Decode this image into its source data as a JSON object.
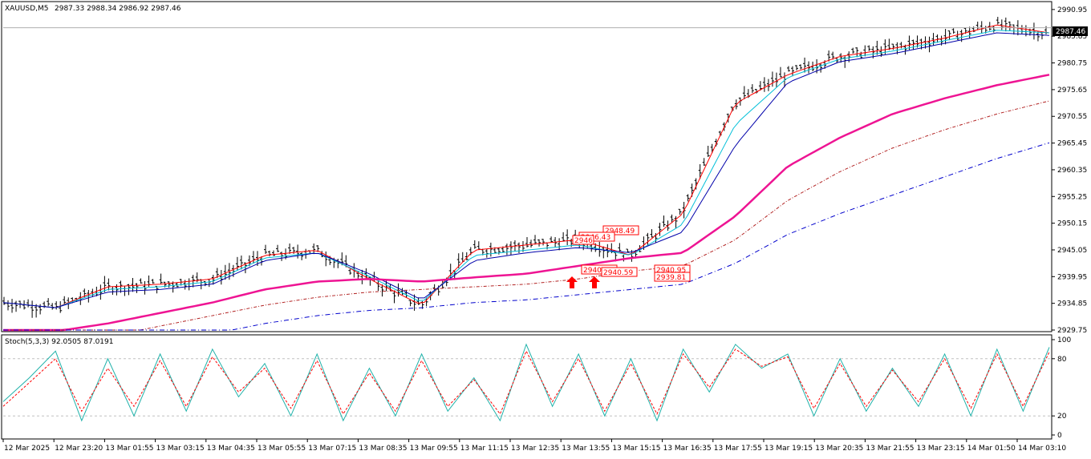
{
  "main_panel": {
    "symbol": "XAUUSD,M5",
    "ohlc": "2987.33 2988.34 2986.92 2987.46",
    "current_price_label": "2987.46",
    "price_ticks": [
      "2990.95",
      "2985.85",
      "2980.75",
      "2975.65",
      "2970.55",
      "2965.45",
      "2960.35",
      "2955.25",
      "2950.15",
      "2945.05",
      "2939.95",
      "2934.85",
      "2929.75"
    ],
    "annotations": [
      "2948.49",
      "2946.43",
      "2946",
      "2940.97",
      "2940.59",
      "2940.95",
      "2939.81"
    ]
  },
  "stoch_panel": {
    "title": "Stoch(5,3,3) 92.0505 87.0191",
    "level_ticks": [
      "100",
      "80",
      "20",
      "0"
    ]
  },
  "time_ticks": [
    "12 Mar 2025",
    "12 Mar 23:20",
    "13 Mar 01:55",
    "13 Mar 03:15",
    "13 Mar 04:35",
    "13 Mar 05:55",
    "13 Mar 07:15",
    "13 Mar 08:35",
    "13 Mar 09:55",
    "13 Mar 11:15",
    "13 Mar 12:35",
    "13 Mar 13:55",
    "13 Mar 15:15",
    "13 Mar 16:35",
    "13 Mar 17:55",
    "13 Mar 19:15",
    "13 Mar 20:35",
    "13 Mar 21:55",
    "13 Mar 23:15",
    "14 Mar 01:50",
    "14 Mar 03:10"
  ],
  "colors": {
    "background": "#ffffff",
    "price_bars": "#000000",
    "ma_fast": "#ff0000",
    "ma_mid": "#00bfd8",
    "ma_slow": "#0000aa",
    "ma_long": "#ee1493",
    "ma_long_dashed": "#b22222",
    "ma_longest_dashed": "#0000cc",
    "stoch_main": "#20b2aa",
    "stoch_signal": "#ff0000",
    "arrows": "#ff0000",
    "grid_level": "#c0c0c0"
  },
  "chart_data": [
    {
      "type": "line",
      "title": "XAUUSD,M5",
      "ylim": [
        2929.75,
        2992.0
      ],
      "x": [
        "12 Mar 2025",
        "12 Mar 23:20",
        "13 Mar 01:55",
        "13 Mar 03:15",
        "13 Mar 04:35",
        "13 Mar 05:55",
        "13 Mar 07:15",
        "13 Mar 08:35",
        "13 Mar 09:55",
        "13 Mar 11:15",
        "13 Mar 12:35",
        "13 Mar 13:55",
        "13 Mar 15:15",
        "13 Mar 16:35",
        "13 Mar 17:55",
        "13 Mar 19:15",
        "13 Mar 20:35",
        "13 Mar 21:55",
        "13 Mar 23:15",
        "14 Mar 01:50",
        "14 Mar 03:10"
      ],
      "series": [
        {
          "values": [
            2935.0,
            2934.0,
            2938.0,
            2938.5,
            2939.5,
            2944.0,
            2945.0,
            2939.5,
            2934.5,
            2945.0,
            2946.0,
            2947.0,
            2944.0,
            2952.0,
            2973.0,
            2978.5,
            2982.0,
            2983.5,
            2985.5,
            2988.0,
            2986.5
          ]
        },
        {
          "values": [
            2935.0,
            2934.0,
            2937.5,
            2938.0,
            2939.0,
            2943.5,
            2944.5,
            2940.0,
            2935.0,
            2944.0,
            2945.0,
            2946.0,
            2944.0,
            2950.0,
            2969.0,
            2978.0,
            2981.5,
            2983.0,
            2985.0,
            2987.0,
            2986.5
          ]
        },
        {
          "values": [
            2935.0,
            2934.0,
            2937.0,
            2937.5,
            2938.5,
            2943.0,
            2944.5,
            2940.5,
            2935.5,
            2943.0,
            2944.5,
            2945.5,
            2944.5,
            2948.5,
            2965.0,
            2977.0,
            2981.0,
            2982.5,
            2984.5,
            2986.5,
            2986.0
          ]
        },
        {
          "values": [
            2929.0,
            2929.5,
            2931.0,
            2933.0,
            2935.0,
            2937.5,
            2939.0,
            2939.5,
            2939.0,
            2939.8,
            2940.5,
            2942.0,
            2943.5,
            2944.5,
            2951.5,
            2961.0,
            2966.5,
            2971.0,
            2974.0,
            2976.5,
            2978.5
          ]
        },
        {
          "values": [
            2927.0,
            2927.5,
            2928.5,
            2930.5,
            2932.5,
            2934.5,
            2936.0,
            2937.0,
            2937.5,
            2938.0,
            2938.5,
            2939.5,
            2941.0,
            2942.0,
            2947.0,
            2954.5,
            2960.0,
            2964.5,
            2968.0,
            2971.0,
            2973.5
          ]
        },
        {
          "values": [
            2924.0,
            2925.0,
            2926.0,
            2927.5,
            2929.0,
            2931.0,
            2932.5,
            2933.5,
            2934.0,
            2935.0,
            2935.5,
            2936.5,
            2937.5,
            2938.5,
            2942.5,
            2948.0,
            2952.0,
            2955.5,
            2959.0,
            2962.5,
            2965.5
          ]
        }
      ]
    },
    {
      "type": "line",
      "title": "Stoch(5,3,3) 92.0505 87.0191",
      "ylim": [
        0,
        100
      ],
      "series": [
        {
          "values": [
            35,
            60,
            88,
            15,
            80,
            20,
            85,
            25,
            90,
            40,
            75,
            20,
            85,
            15,
            70,
            20,
            85,
            25,
            60,
            15,
            95,
            30,
            85,
            20,
            80,
            15,
            90,
            45,
            95,
            70,
            85,
            20,
            80,
            25,
            70,
            30,
            85,
            20,
            90,
            25,
            92
          ]
        },
        {
          "values": [
            30,
            55,
            80,
            25,
            70,
            30,
            78,
            30,
            82,
            45,
            70,
            28,
            78,
            22,
            65,
            25,
            78,
            30,
            58,
            22,
            88,
            35,
            80,
            25,
            75,
            22,
            85,
            50,
            90,
            72,
            82,
            28,
            75,
            30,
            68,
            35,
            80,
            28,
            85,
            30,
            87
          ]
        }
      ]
    }
  ]
}
